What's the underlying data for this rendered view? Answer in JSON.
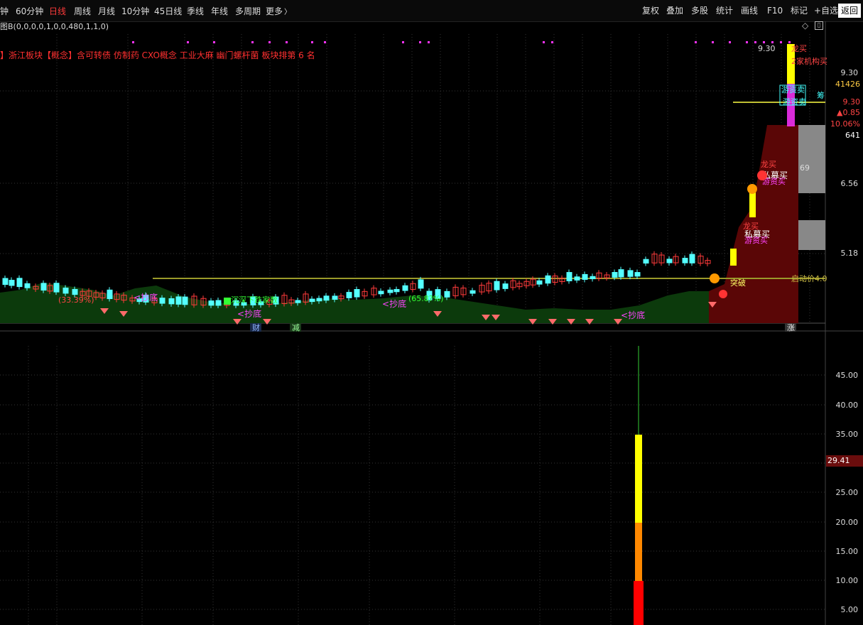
{
  "toolbar": {
    "left_items": [
      "钟",
      "60分钟",
      "日线",
      "周线",
      "月线",
      "10分钟",
      "45日线",
      "季线",
      "年线",
      "多周期",
      "更多"
    ],
    "active": "日线",
    "right_items": [
      "复权",
      "叠加",
      "多股",
      "统计",
      "画线",
      "F10",
      "标记",
      "+自选",
      "返回"
    ],
    "selected": "返回"
  },
  "formula_text": "图B(0,0,0,0,1,0,0,480,1,1,0)",
  "concepts_text": "】浙江板块【概念】含可转债 仿制药 CXO概念 工业大麻 幽门螺杆菌  板块排第  6  名",
  "annotations": {
    "bottom_tabs": [
      "财",
      "减"
    ],
    "last_tab": "涨",
    "chaodi": "抄底",
    "pct1": "(33.39%)",
    "pct2": "(65.8?%)",
    "decline_text": "沉深下跌家数",
    "breakout": "突破",
    "start_price": "启动价4.0",
    "longmai": "龙买",
    "simu": "私募买",
    "youzi": "游资买",
    "youzi_sell": "游资卖",
    "jigou": "2家机构买",
    "price_tag": "9.30",
    "chou": "筹",
    "mid_num": "69"
  },
  "right_panel": {
    "close": "9.30",
    "volume": "41426",
    "price2": "9.30",
    "change": "▲0.85",
    "change_pct": "10.06%",
    "count": "641"
  },
  "price_axis": [
    "9.30",
    "6.56",
    "5.18"
  ],
  "indicator_axis": [
    "45.00",
    "40.00",
    "35.00",
    "30.00",
    "25.00",
    "20.00",
    "15.00",
    "10.00",
    "5.00"
  ],
  "indicator_current": "29.41",
  "colors": {
    "up": "#ff3b3b",
    "down": "#54ffff",
    "green_fill": "#0c3a0c",
    "red_fill": "#5a0606",
    "yellow": "#ffff00"
  },
  "icons": [
    "chevron-right-icon",
    "diamond-icon",
    "collapse-icon"
  ]
}
